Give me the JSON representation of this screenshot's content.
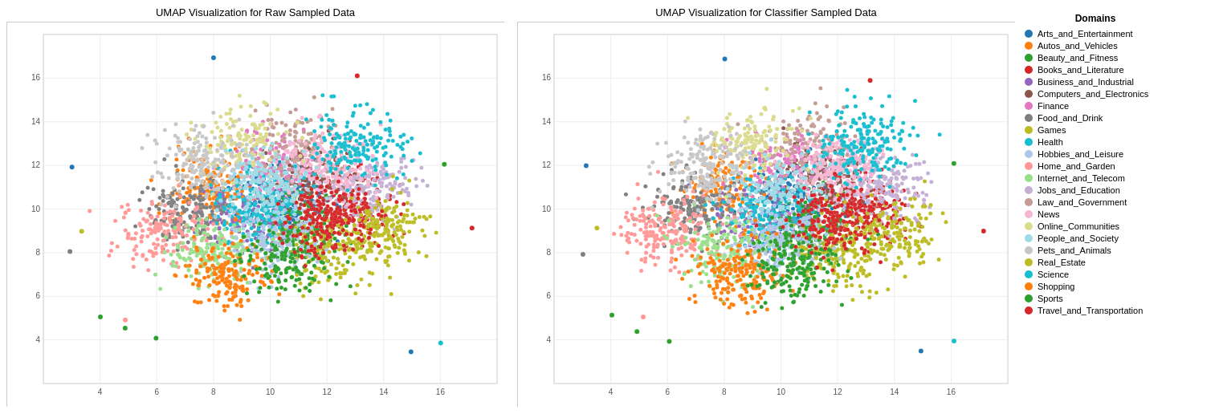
{
  "chart1": {
    "title": "UMAP Visualization for Raw Sampled Data"
  },
  "chart2": {
    "title": "UMAP Visualization for Classifier Sampled Data"
  },
  "legend": {
    "title": "Domains",
    "items": [
      {
        "label": "Arts_and_Entertainment",
        "color": "#1f77b4"
      },
      {
        "label": "Autos_and_Vehicles",
        "color": "#ff7f0e"
      },
      {
        "label": "Beauty_and_Fitness",
        "color": "#2ca02c"
      },
      {
        "label": "Books_and_Literature",
        "color": "#d62728"
      },
      {
        "label": "Business_and_Industrial",
        "color": "#9467bd"
      },
      {
        "label": "Computers_and_Electronics",
        "color": "#8c564b"
      },
      {
        "label": "Finance",
        "color": "#e377c2"
      },
      {
        "label": "Food_and_Drink",
        "color": "#7f7f7f"
      },
      {
        "label": "Games",
        "color": "#bcbd22"
      },
      {
        "label": "Health",
        "color": "#17becf"
      },
      {
        "label": "Hobbies_and_Leisure",
        "color": "#aec7e8"
      },
      {
        "label": "Home_and_Garden",
        "color": "#ff9896"
      },
      {
        "label": "Internet_and_Telecom",
        "color": "#98df8a"
      },
      {
        "label": "Jobs_and_Education",
        "color": "#c5b0d5"
      },
      {
        "label": "Law_and_Government",
        "color": "#c49c94"
      },
      {
        "label": "News",
        "color": "#f7b6d2"
      },
      {
        "label": "Online_Communities",
        "color": "#dbdb8d"
      },
      {
        "label": "People_and_Society",
        "color": "#9edae5"
      },
      {
        "label": "Pets_and_Animals",
        "color": "#c7c7c7"
      },
      {
        "label": "Real_Estate",
        "color": "#bcbd22"
      },
      {
        "label": "Science",
        "color": "#17becf"
      },
      {
        "label": "Shopping",
        "color": "#ff7f0e"
      },
      {
        "label": "Sports",
        "color": "#2ca02c"
      },
      {
        "label": "Travel_and_Transportation",
        "color": "#d62728"
      }
    ]
  },
  "axes": {
    "x_ticks": [
      "4",
      "6",
      "8",
      "10",
      "12",
      "14",
      "16"
    ],
    "y_ticks": [
      "4",
      "6",
      "8",
      "10",
      "12",
      "14",
      "16"
    ]
  }
}
